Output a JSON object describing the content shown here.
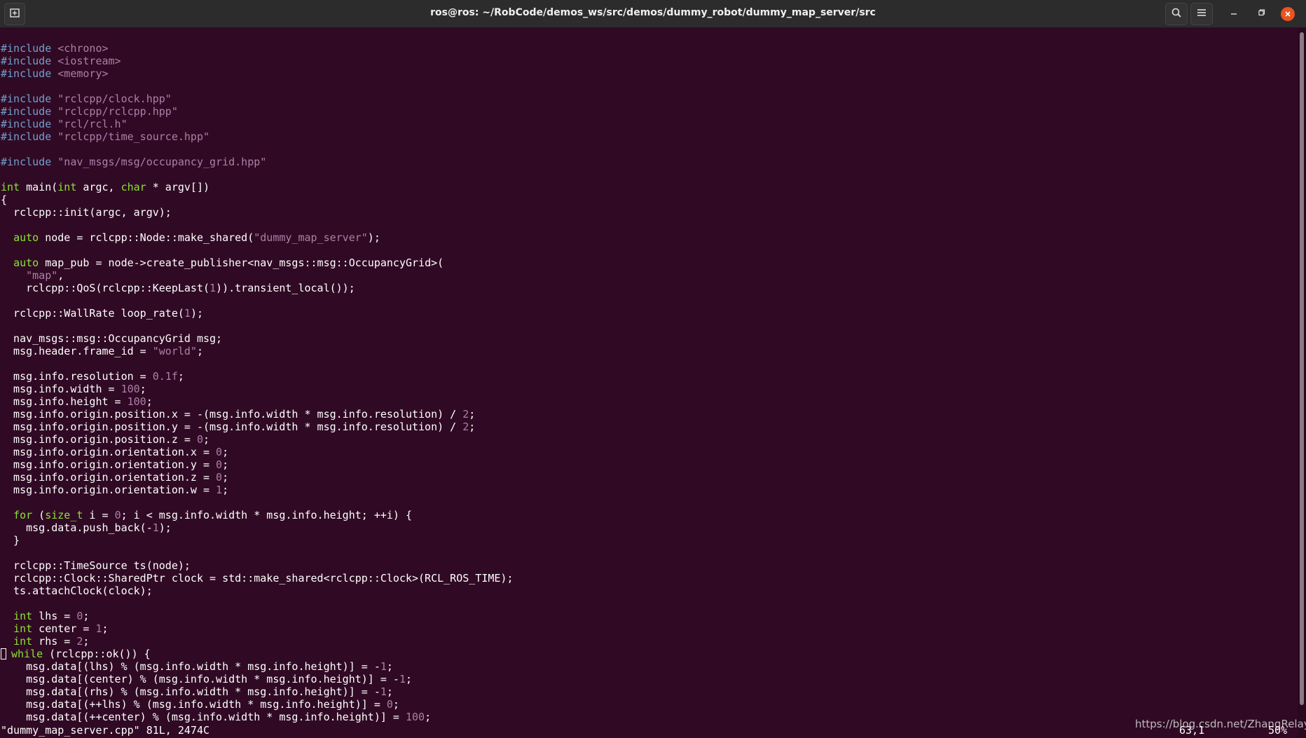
{
  "window": {
    "title": "ros@ros: ~/RobCode/demos_ws/src/demos/dummy_robot/dummy_map_server/src"
  },
  "icons": {
    "new_tab": "new-tab-icon",
    "search": "search-icon",
    "menu": "hamburger-menu-icon",
    "minimize": "minimize-icon",
    "maximize": "maximize-icon",
    "close": "close-icon"
  },
  "colors": {
    "background": "#300a24",
    "keyword": "#8ae234",
    "preprocessor": "#729fcf",
    "string_number": "#ad7fa8",
    "close_button": "#e95420"
  },
  "editor": {
    "lines": [
      [
        {
          "t": "#include",
          "c": "pp"
        },
        {
          "t": " "
        },
        {
          "t": "<chrono>",
          "c": "st"
        }
      ],
      [
        {
          "t": "#include",
          "c": "pp"
        },
        {
          "t": " "
        },
        {
          "t": "<iostream>",
          "c": "st"
        }
      ],
      [
        {
          "t": "#include",
          "c": "pp"
        },
        {
          "t": " "
        },
        {
          "t": "<memory>",
          "c": "st"
        }
      ],
      [],
      [
        {
          "t": "#include",
          "c": "pp"
        },
        {
          "t": " "
        },
        {
          "t": "\"rclcpp/clock.hpp\"",
          "c": "st"
        }
      ],
      [
        {
          "t": "#include",
          "c": "pp"
        },
        {
          "t": " "
        },
        {
          "t": "\"rclcpp/rclcpp.hpp\"",
          "c": "st"
        }
      ],
      [
        {
          "t": "#include",
          "c": "pp"
        },
        {
          "t": " "
        },
        {
          "t": "\"rcl/rcl.h\"",
          "c": "st"
        }
      ],
      [
        {
          "t": "#include",
          "c": "pp"
        },
        {
          "t": " "
        },
        {
          "t": "\"rclcpp/time_source.hpp\"",
          "c": "st"
        }
      ],
      [],
      [
        {
          "t": "#include",
          "c": "pp"
        },
        {
          "t": " "
        },
        {
          "t": "\"nav_msgs/msg/occupancy_grid.hpp\"",
          "c": "st"
        }
      ],
      [],
      [
        {
          "t": "int",
          "c": "kw"
        },
        {
          "t": " main("
        },
        {
          "t": "int",
          "c": "kw"
        },
        {
          "t": " argc, "
        },
        {
          "t": "char",
          "c": "kw"
        },
        {
          "t": " * argv[])"
        }
      ],
      [
        {
          "t": "{"
        }
      ],
      [
        {
          "t": "  rclcpp::init(argc, argv);"
        }
      ],
      [],
      [
        {
          "t": "  "
        },
        {
          "t": "auto",
          "c": "kw"
        },
        {
          "t": " node = rclcpp::Node::make_shared("
        },
        {
          "t": "\"dummy_map_server\"",
          "c": "st"
        },
        {
          "t": ");"
        }
      ],
      [],
      [
        {
          "t": "  "
        },
        {
          "t": "auto",
          "c": "kw"
        },
        {
          "t": " map_pub = node->create_publisher<nav_msgs::msg::OccupancyGrid>("
        }
      ],
      [
        {
          "t": "    "
        },
        {
          "t": "\"map\"",
          "c": "st"
        },
        {
          "t": ","
        }
      ],
      [
        {
          "t": "    rclcpp::QoS(rclcpp::KeepLast("
        },
        {
          "t": "1",
          "c": "num"
        },
        {
          "t": ")).transient_local());"
        }
      ],
      [],
      [
        {
          "t": "  rclcpp::WallRate loop_rate("
        },
        {
          "t": "1",
          "c": "num"
        },
        {
          "t": ");"
        }
      ],
      [],
      [
        {
          "t": "  nav_msgs::msg::OccupancyGrid msg;"
        }
      ],
      [
        {
          "t": "  msg.header.frame_id = "
        },
        {
          "t": "\"world\"",
          "c": "st"
        },
        {
          "t": ";"
        }
      ],
      [],
      [
        {
          "t": "  msg.info.resolution = "
        },
        {
          "t": "0.1f",
          "c": "num"
        },
        {
          "t": ";"
        }
      ],
      [
        {
          "t": "  msg.info.width = "
        },
        {
          "t": "100",
          "c": "num"
        },
        {
          "t": ";"
        }
      ],
      [
        {
          "t": "  msg.info.height = "
        },
        {
          "t": "100",
          "c": "num"
        },
        {
          "t": ";"
        }
      ],
      [
        {
          "t": "  msg.info.origin.position.x = -(msg.info.width * msg.info.resolution) / "
        },
        {
          "t": "2",
          "c": "num"
        },
        {
          "t": ";"
        }
      ],
      [
        {
          "t": "  msg.info.origin.position.y = -(msg.info.width * msg.info.resolution) / "
        },
        {
          "t": "2",
          "c": "num"
        },
        {
          "t": ";"
        }
      ],
      [
        {
          "t": "  msg.info.origin.position.z = "
        },
        {
          "t": "0",
          "c": "num"
        },
        {
          "t": ";"
        }
      ],
      [
        {
          "t": "  msg.info.origin.orientation.x = "
        },
        {
          "t": "0",
          "c": "num"
        },
        {
          "t": ";"
        }
      ],
      [
        {
          "t": "  msg.info.origin.orientation.y = "
        },
        {
          "t": "0",
          "c": "num"
        },
        {
          "t": ";"
        }
      ],
      [
        {
          "t": "  msg.info.origin.orientation.z = "
        },
        {
          "t": "0",
          "c": "num"
        },
        {
          "t": ";"
        }
      ],
      [
        {
          "t": "  msg.info.origin.orientation.w = "
        },
        {
          "t": "1",
          "c": "num"
        },
        {
          "t": ";"
        }
      ],
      [],
      [
        {
          "t": "  "
        },
        {
          "t": "for",
          "c": "kw"
        },
        {
          "t": " ("
        },
        {
          "t": "size_t",
          "c": "kw"
        },
        {
          "t": " i = "
        },
        {
          "t": "0",
          "c": "num"
        },
        {
          "t": "; i < msg.info.width * msg.info.height; ++i) {"
        }
      ],
      [
        {
          "t": "    msg.data.push_back(-"
        },
        {
          "t": "1",
          "c": "num"
        },
        {
          "t": ");"
        }
      ],
      [
        {
          "t": "  }"
        }
      ],
      [],
      [
        {
          "t": "  rclcpp::TimeSource ts(node);"
        }
      ],
      [
        {
          "t": "  rclcpp::Clock::SharedPtr clock = std::make_shared<rclcpp::Clock>(RCL_ROS_TIME);"
        }
      ],
      [
        {
          "t": "  ts.attachClock(clock);"
        }
      ],
      [],
      [
        {
          "t": "  "
        },
        {
          "t": "int",
          "c": "kw"
        },
        {
          "t": " lhs = "
        },
        {
          "t": "0",
          "c": "num"
        },
        {
          "t": ";"
        }
      ],
      [
        {
          "t": "  "
        },
        {
          "t": "int",
          "c": "kw"
        },
        {
          "t": " center = "
        },
        {
          "t": "1",
          "c": "num"
        },
        {
          "t": ";"
        }
      ],
      [
        {
          "t": "  "
        },
        {
          "t": "int",
          "c": "kw"
        },
        {
          "t": " rhs = "
        },
        {
          "t": "2",
          "c": "num"
        },
        {
          "t": ";"
        }
      ],
      [
        {
          "t": "",
          "cursor": true
        },
        {
          "t": "while",
          "c": "kw"
        },
        {
          "t": " (rclcpp::ok()) {"
        }
      ],
      [
        {
          "t": "    msg.data[(lhs) % (msg.info.width * msg.info.height)] = -"
        },
        {
          "t": "1",
          "c": "num"
        },
        {
          "t": ";"
        }
      ],
      [
        {
          "t": "    msg.data[(center) % (msg.info.width * msg.info.height)] = -"
        },
        {
          "t": "1",
          "c": "num"
        },
        {
          "t": ";"
        }
      ],
      [
        {
          "t": "    msg.data[(rhs) % (msg.info.width * msg.info.height)] = -"
        },
        {
          "t": "1",
          "c": "num"
        },
        {
          "t": ";"
        }
      ],
      [
        {
          "t": "    msg.data[(++lhs) % (msg.info.width * msg.info.height)] = "
        },
        {
          "t": "0",
          "c": "num"
        },
        {
          "t": ";"
        }
      ],
      [
        {
          "t": "    msg.data[(++center) % (msg.info.width * msg.info.height)] = "
        },
        {
          "t": "100",
          "c": "num"
        },
        {
          "t": ";"
        }
      ]
    ]
  },
  "statusbar": {
    "file_info": "\"dummy_map_server.cpp\" 81L, 2474C",
    "cursor_pos": "63,1",
    "scroll_percent": "50%"
  },
  "watermark": "https://blog.csdn.net/ZhangRelay",
  "scroll": {
    "position_fraction": 0.5
  }
}
